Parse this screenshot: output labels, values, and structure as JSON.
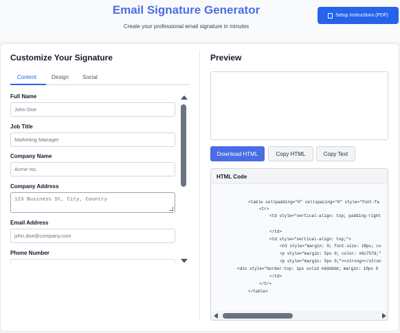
{
  "header": {
    "title": "Email Signature Generator",
    "subtitle": "Create your professional email signature in minutes",
    "setup_button": "Setup Instructions (PDF)",
    "setup_icon": "document-icon"
  },
  "left_panel": {
    "title": "Customize Your Signature",
    "tabs": [
      {
        "label": "Content",
        "active": true
      },
      {
        "label": "Design",
        "active": false
      },
      {
        "label": "Social",
        "active": false
      }
    ],
    "fields": {
      "full_name": {
        "label": "Full Name",
        "placeholder": "John Doe"
      },
      "job_title": {
        "label": "Job Title",
        "placeholder": "Marketing Manager"
      },
      "company_name": {
        "label": "Company Name",
        "placeholder": "Acme Inc."
      },
      "company_address": {
        "label": "Company Address",
        "placeholder": "123 Business St, City, Country"
      },
      "email_address": {
        "label": "Email Address",
        "placeholder": "john.doe@company.com"
      },
      "phone_number": {
        "label": "Phone Number",
        "placeholder": ""
      }
    }
  },
  "right_panel": {
    "title": "Preview",
    "buttons": {
      "download_html": "Download HTML",
      "copy_html": "Copy HTML",
      "copy_text": "Copy Text"
    },
    "code_title": "HTML Code",
    "code_lines": [
      "<table cellpadding=\"0\" cellspacing=\"0\" style=\"font-fa",
      "<tr>",
      "<td style=\"vertical-align: top; padding-right",
      "",
      "</td>",
      "<td style=\"vertical-align: top;\">",
      "<h3 style=\"margin: 0; font-size: 18px; co",
      "<p style=\"margin: 5px 0; color: #6c757d;\"",
      "<p style=\"margin: 5px 0;\"><strong></stron",
      "<div style=\"border-top: 1px solid #dddddd; margin: 10px 0",
      "</td>",
      "</tr>",
      "</table>"
    ]
  },
  "colors": {
    "accent": "#4a6de5",
    "setup_button": "#2563eb",
    "active_tab": "#2563eb"
  }
}
